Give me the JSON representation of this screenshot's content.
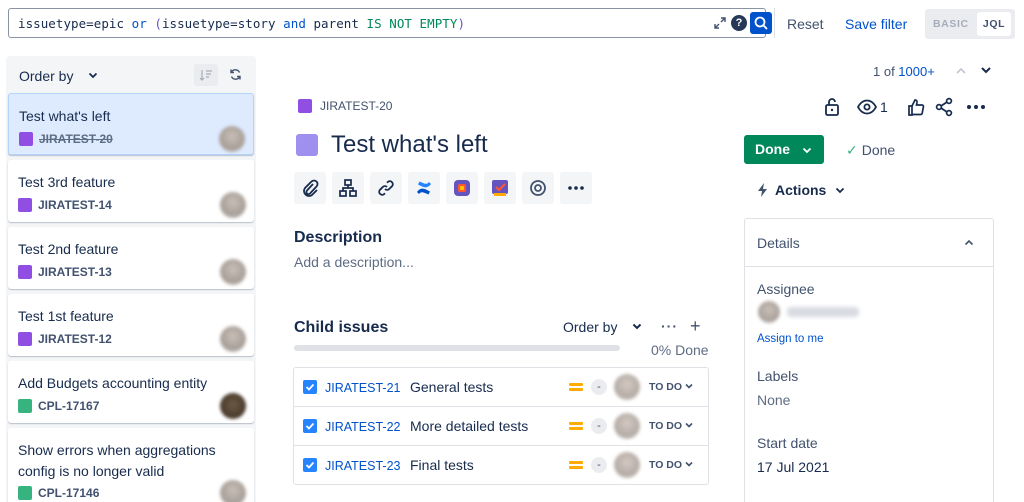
{
  "jql": {
    "query_parts": [
      "issuetype=epic ",
      "or",
      " (",
      "issuetype=story ",
      "and",
      " parent ",
      "IS NOT EMPTY",
      ")"
    ],
    "reset_label": "Reset",
    "save_label": "Save filter",
    "mode_basic": "BASIC",
    "mode_jql": "JQL"
  },
  "list": {
    "order_label": "Order by",
    "items": [
      {
        "title": "Test what's left",
        "key": "JIRATEST-20",
        "type": "epic",
        "done": true
      },
      {
        "title": "Test 3rd feature",
        "key": "JIRATEST-14",
        "type": "epic",
        "done": false
      },
      {
        "title": "Test 2nd feature",
        "key": "JIRATEST-13",
        "type": "epic",
        "done": false
      },
      {
        "title": "Test 1st feature",
        "key": "JIRATEST-12",
        "type": "epic",
        "done": false
      },
      {
        "title": "Add Budgets accounting entity",
        "key": "CPL-17167",
        "type": "story",
        "done": false
      },
      {
        "title": "Show errors when aggregations config is no longer valid",
        "key": "CPL-17146",
        "type": "story",
        "done": false
      }
    ]
  },
  "pager": {
    "current": "1 of ",
    "total": "1000+"
  },
  "issue": {
    "key": "JIRATEST-20",
    "title": "Test what's left",
    "watch_count": "1",
    "description_label": "Description",
    "description_placeholder": "Add a description...",
    "child_issues_label": "Child issues",
    "child_order_label": "Order by",
    "progress_pct": 0,
    "progress_label": "0% Done",
    "children": [
      {
        "key": "JIRATEST-21",
        "summary": "General tests",
        "estimate": "-",
        "status": "TO DO"
      },
      {
        "key": "JIRATEST-22",
        "summary": "More detailed tests",
        "estimate": "-",
        "status": "TO DO"
      },
      {
        "key": "JIRATEST-23",
        "summary": "Final tests",
        "estimate": "-",
        "status": "TO DO"
      }
    ]
  },
  "sidebar": {
    "status_button": "Done",
    "resolution": "Done",
    "actions_label": "Actions",
    "details_title": "Details",
    "assignee_label": "Assignee",
    "assign_to_me": "Assign to me",
    "labels_label": "Labels",
    "labels_value": "None",
    "start_date_label": "Start date",
    "start_date_value": "17 Jul 2021"
  },
  "colors": {
    "accent": "#0052cc",
    "done_green": "#00875a",
    "epic_purple": "#904ee2",
    "story_green": "#36b37e"
  }
}
